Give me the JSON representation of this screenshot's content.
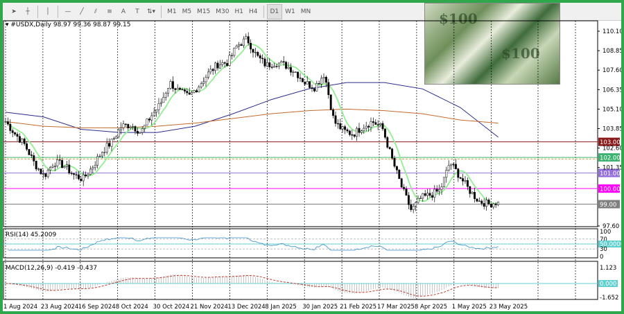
{
  "toolbar": {
    "tools": [
      {
        "name": "cursor-icon",
        "g": "➤"
      },
      {
        "name": "crosshair-icon",
        "g": "┼"
      },
      {
        "name": "vertical-line-icon",
        "g": "│"
      },
      {
        "name": "horizontal-line-icon",
        "g": "—"
      },
      {
        "name": "trendline-icon",
        "g": "╱"
      },
      {
        "name": "equidistant-channel-icon",
        "g": "⫽"
      },
      {
        "name": "fibonacci-icon",
        "g": "≡"
      },
      {
        "name": "text-icon",
        "g": "A"
      },
      {
        "name": "text-label-icon",
        "g": "T"
      },
      {
        "name": "arrows-icon",
        "g": "⇅▾"
      }
    ],
    "timeframes": [
      "M1",
      "M5",
      "M15",
      "M30",
      "H1",
      "H4",
      "D1",
      "W1",
      "MN"
    ],
    "active_timeframe": "D1"
  },
  "chart": {
    "title": "#USDX,Daily",
    "ohlc": "98.97 99.36 98.87 99.15",
    "price_ticks": [
      "110.10",
      "108.85",
      "107.60",
      "106.35",
      "105.10",
      "103.85",
      "102.60",
      "101.35",
      "97.60"
    ],
    "levels": [
      {
        "label": "103.00",
        "value": 103.0,
        "color": "#8b1a1a"
      },
      {
        "label": "102.00",
        "value": 102.0,
        "color": "#3cb371"
      },
      {
        "label": "101.00",
        "value": 101.0,
        "color": "#9370db"
      },
      {
        "label": "100.00",
        "value": 100.0,
        "color": "#ff00ff"
      },
      {
        "label": "99.00",
        "value": 99.0,
        "color": "#808080"
      }
    ],
    "dates": [
      "1 Aug 2024",
      "23 Aug 2024",
      "16 Sep 2024",
      "8 Oct 2024",
      "30 Oct 2024",
      "21 Nov 2024",
      "13 Dec 2024",
      "8 Jan 2025",
      "30 Jan 2025",
      "21 Feb 2025",
      "17 Mar 2025",
      "8 Apr 2025",
      "1 May 2025",
      "23 May 2025"
    ],
    "close_anchors": [
      104.3,
      103.5,
      102.8,
      101.6,
      100.8,
      101.7,
      101.5,
      100.9,
      100.6,
      101.4,
      102.4,
      103.0,
      104.0,
      104.1,
      103.6,
      104.6,
      105.4,
      106.8,
      106.2,
      105.9,
      106.6,
      107.4,
      108.0,
      108.1,
      109.2,
      109.6,
      108.5,
      107.9,
      108.1,
      107.9,
      107.5,
      106.8,
      106.5,
      107.4,
      104.3,
      103.7,
      103.5,
      104.0,
      104.3,
      103.9,
      101.9,
      100.1,
      98.6,
      99.4,
      99.6,
      99.9,
      101.7,
      100.8,
      99.9,
      99.2,
      99.0,
      99.15
    ],
    "ma_blue": [
      104.9,
      104.6,
      103.8,
      103.6,
      103.6,
      104.0,
      104.8,
      105.7,
      106.4,
      106.8,
      106.8,
      106.4,
      105.2,
      103.3
    ],
    "ma_orange": [
      104.3,
      104.0,
      103.9,
      103.9,
      104.0,
      104.2,
      104.5,
      104.8,
      105.0,
      105.1,
      105.0,
      104.8,
      104.4,
      104.2
    ],
    "colors": {
      "ma_fast": "#90ee90",
      "ma_blue": "#2b2b8f",
      "ma_orange": "#c46a2c"
    }
  },
  "rsi": {
    "label": "RSI(14) 45.2009",
    "levels": [
      "100",
      "70",
      "50.0000",
      "30",
      "0"
    ]
  },
  "macd": {
    "label": "MACD(12,26,9) -0.419 -0.437",
    "levels": [
      "1.123",
      "0.000",
      "-1.652"
    ]
  }
}
